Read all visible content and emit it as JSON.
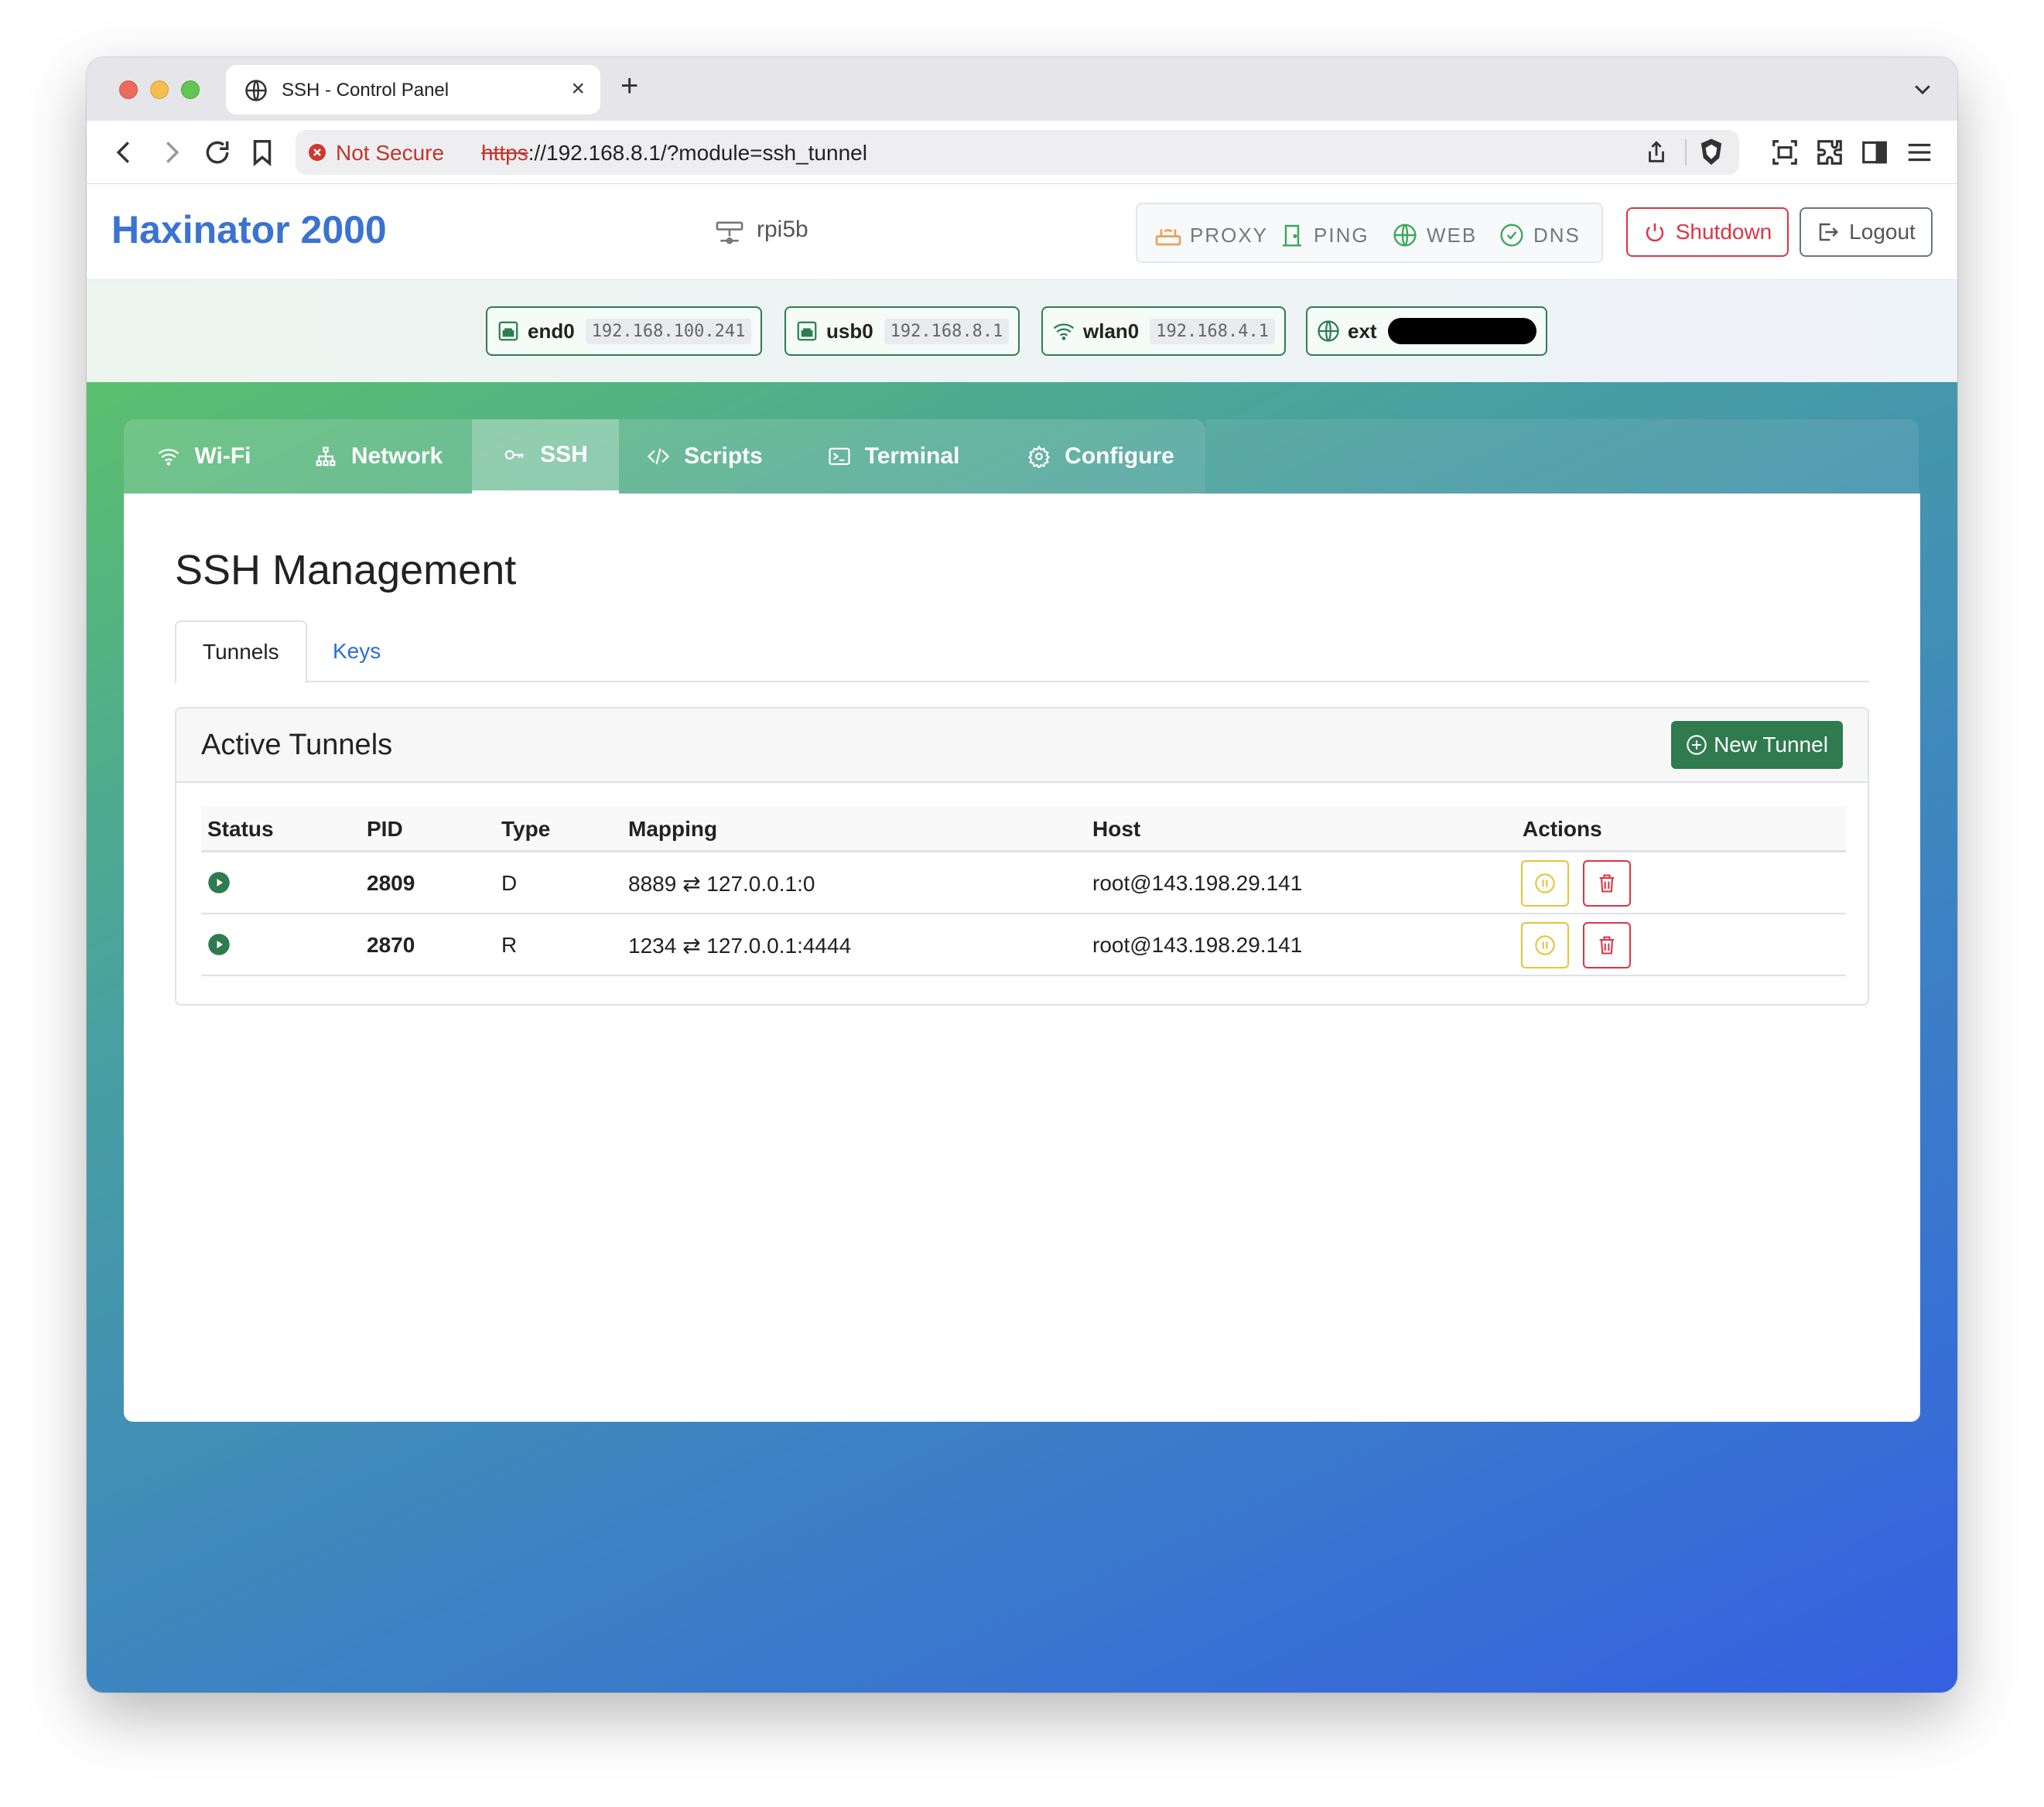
{
  "browser": {
    "tab_title": "SSH - Control Panel",
    "new_tab_label": "+",
    "close_label": "×",
    "security_label": "Not Secure",
    "url_scheme": "https",
    "url_rest": "://192.168.8.1/?module=ssh_tunnel"
  },
  "header": {
    "brand": "Haxinator 2000",
    "hostname": "rpi5b",
    "services": [
      {
        "label": "PROXY",
        "icon": "router-icon",
        "color": "#e8a15a"
      },
      {
        "label": "PING",
        "icon": "door-icon",
        "color": "#3aa85a"
      },
      {
        "label": "WEB",
        "icon": "globe-icon",
        "color": "#3aa85a"
      },
      {
        "label": "DNS",
        "icon": "dns-icon",
        "color": "#3aa85a"
      }
    ],
    "shutdown_label": "Shutdown",
    "logout_label": "Logout"
  },
  "interfaces": [
    {
      "name": "end0",
      "ip": "192.168.100.241",
      "icon": "ethernet-icon"
    },
    {
      "name": "usb0",
      "ip": "192.168.8.1",
      "icon": "ethernet-icon"
    },
    {
      "name": "wlan0",
      "ip": "192.168.4.1",
      "icon": "wifi-icon"
    },
    {
      "name": "ext",
      "ip": "",
      "icon": "globe-icon",
      "redacted": true
    }
  ],
  "nav": {
    "tabs": [
      {
        "label": "Wi-Fi",
        "icon": "wifi-icon"
      },
      {
        "label": "Network",
        "icon": "network-icon"
      },
      {
        "label": "SSH",
        "icon": "key-icon",
        "active": true
      },
      {
        "label": "Scripts",
        "icon": "code-icon"
      },
      {
        "label": "Terminal",
        "icon": "terminal-icon"
      },
      {
        "label": "Configure",
        "icon": "gear-icon"
      }
    ]
  },
  "main": {
    "title": "SSH Management",
    "subtabs": [
      {
        "label": "Tunnels",
        "active": true
      },
      {
        "label": "Keys",
        "active": false
      }
    ],
    "card_title": "Active Tunnels",
    "new_tunnel_label": "New Tunnel",
    "columns": [
      "Status",
      "PID",
      "Type",
      "Mapping",
      "Host",
      "Actions"
    ],
    "rows": [
      {
        "status": "running",
        "pid": "2809",
        "type": "D",
        "mapping": "8889 ⇄ 127.0.0.1:0",
        "host": "root@143.198.29.141"
      },
      {
        "status": "running",
        "pid": "2870",
        "type": "R",
        "mapping": "1234 ⇄ 127.0.0.1:4444",
        "host": "root@143.198.29.141"
      }
    ]
  },
  "colors": {
    "brand": "#3a73d0",
    "danger": "#dc3545",
    "success": "#2f7a4f",
    "warning": "#e8c33c"
  }
}
